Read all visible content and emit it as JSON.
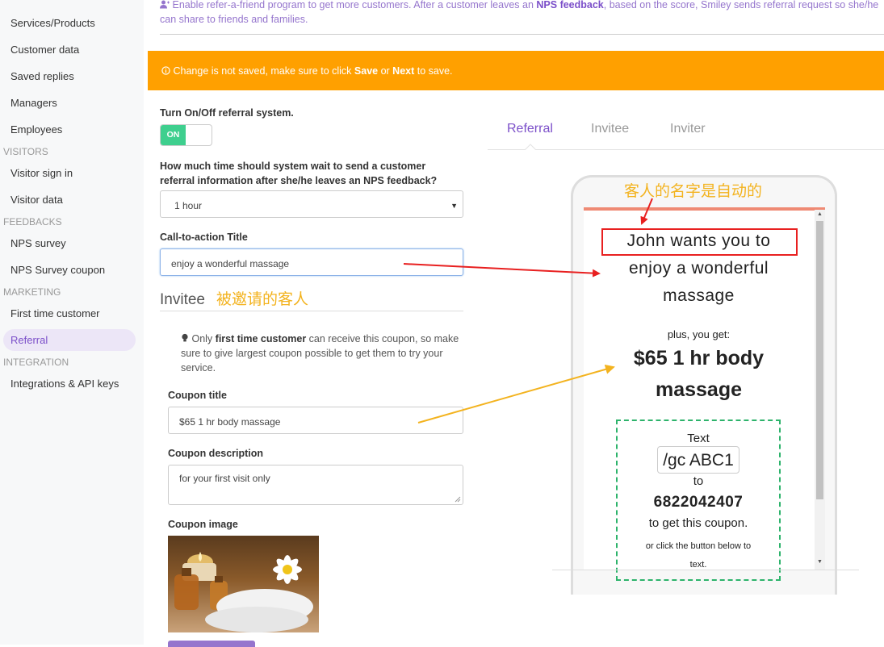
{
  "sidebar": {
    "items": [
      {
        "label": "Services/Products",
        "type": "item"
      },
      {
        "label": "Customer data",
        "type": "item"
      },
      {
        "label": "Saved replies",
        "type": "item"
      },
      {
        "label": "Managers",
        "type": "item"
      },
      {
        "label": "Employees",
        "type": "item"
      },
      {
        "label": "VISITORS",
        "type": "section"
      },
      {
        "label": "Visitor sign in",
        "type": "item"
      },
      {
        "label": "Visitor data",
        "type": "item"
      },
      {
        "label": "FEEDBACKS",
        "type": "section"
      },
      {
        "label": "NPS survey",
        "type": "item"
      },
      {
        "label": "NPS Survey coupon",
        "type": "item"
      },
      {
        "label": "MARKETING",
        "type": "section"
      },
      {
        "label": "First time customer",
        "type": "item"
      },
      {
        "label": "Referral",
        "type": "item",
        "active": true
      },
      {
        "label": "INTEGRATION",
        "type": "section"
      },
      {
        "label": "Integrations & API keys",
        "type": "item"
      }
    ]
  },
  "header": {
    "note_pre": "Enable refer-a-friend program to get more customers. After a customer leaves an ",
    "note_bold": "NPS feedback",
    "note_post": ", based on the score, Smiley sends referral request so she/he can share to friends and families."
  },
  "banner": {
    "icon": "info-icon",
    "pre": "Change is not saved, make sure to click ",
    "save": "Save",
    "mid": " or ",
    "next": "Next",
    "post": " to save.",
    "color": "#ffa000"
  },
  "form": {
    "toggle_label": "Turn On/Off referral system.",
    "toggle_state": "ON",
    "wait_label": "How much time should system wait to send a customer referral information after she/he leaves an NPS feedback?",
    "wait_value": "1 hour",
    "cta_label": "Call-to-action Title",
    "cta_value": "enjoy a wonderful massage",
    "invitee_heading": "Invitee",
    "invitee_note_cn": "被邀请的客人",
    "tip_pre": "Only ",
    "tip_bold": "first time customer",
    "tip_post": " can receive this coupon, so make sure to give largest coupon possible to get them to try your service.",
    "coupon_title_label": "Coupon title",
    "coupon_title_value": "$65 1 hr body massage",
    "coupon_desc_label": "Coupon description",
    "coupon_desc_value": "for your first visit only",
    "coupon_image_label": "Coupon image"
  },
  "tabs": [
    {
      "label": "Referral",
      "active": true
    },
    {
      "label": "Invitee",
      "active": false
    },
    {
      "label": "Inviter",
      "active": false
    }
  ],
  "preview": {
    "annotation_cn": "客人的名字是自动的",
    "headline_name": "John wants you to",
    "headline_line2": "enjoy a wonderful",
    "headline_line3": "massage",
    "plus": "plus, you get:",
    "offer_line1": "$65 1 hr body",
    "offer_line2": "massage",
    "text_word": "Text",
    "code": "/gc ABC1",
    "to_word": "to",
    "phone_number": "6822042407",
    "get_coupon": "to get this coupon.",
    "or_click_1": "or click the button below to",
    "or_click_2": "text."
  },
  "colors": {
    "accent": "#7b4fc9",
    "toggle_on": "#3ecf8e",
    "annotation_red": "#e82020",
    "annotation_yellow": "#f3b31f",
    "dashed_border": "#2db36b"
  }
}
